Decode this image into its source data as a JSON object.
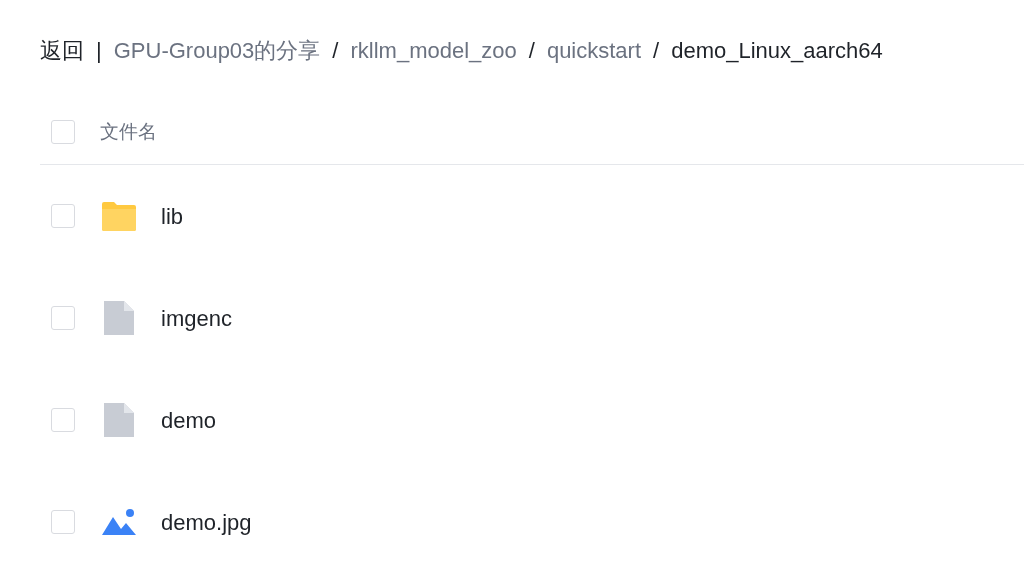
{
  "breadcrumb": {
    "back": "返回",
    "divider": "|",
    "items": [
      {
        "label": "GPU-Group03的分享",
        "current": false
      },
      {
        "separator": "/",
        "label": "rkllm_model_zoo",
        "current": false
      },
      {
        "separator": "/",
        "label": "quickstart",
        "current": false
      },
      {
        "separator": "/",
        "label": "demo_Linux_aarch64",
        "current": true
      }
    ]
  },
  "header": {
    "checked": false,
    "column": "文件名"
  },
  "files": [
    {
      "kind": "folder",
      "name": "lib",
      "checked": false
    },
    {
      "kind": "file",
      "name": "imgenc",
      "checked": false
    },
    {
      "kind": "file",
      "name": "demo",
      "checked": false
    },
    {
      "kind": "image",
      "name": "demo.jpg",
      "checked": false
    }
  ]
}
